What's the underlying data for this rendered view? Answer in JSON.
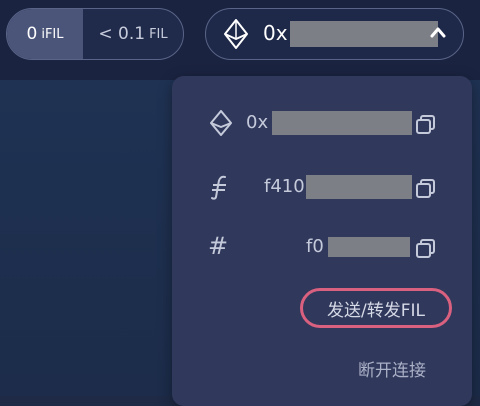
{
  "balance": {
    "ifil_value": "0",
    "ifil_unit": "iFIL",
    "fil_value": "< 0.1",
    "fil_unit": "FIL"
  },
  "wallet_button": {
    "address_prefix": "0x",
    "icon": "ethereum-icon",
    "chevron": "chevron-up-icon"
  },
  "dropdown": {
    "eth_address_prefix": "0x",
    "filecoin_address_prefix": "f410",
    "id_address_prefix": "f0",
    "id_icon_text": "#",
    "send_label": "发送/转发FIL",
    "disconnect_label": "断开连接"
  },
  "colors": {
    "accent_pink": "#d9607f",
    "panel": "#30395c",
    "background": "#1e2a46"
  }
}
